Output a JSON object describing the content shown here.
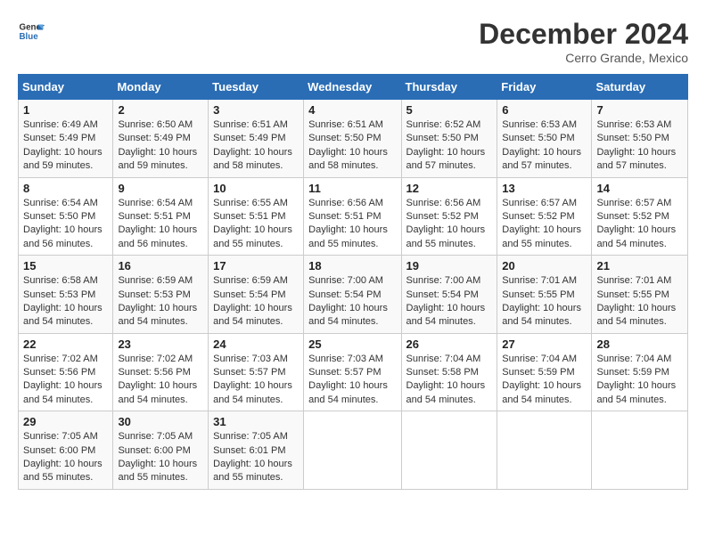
{
  "header": {
    "logo_line1": "General",
    "logo_line2": "Blue",
    "month": "December 2024",
    "location": "Cerro Grande, Mexico"
  },
  "columns": [
    "Sunday",
    "Monday",
    "Tuesday",
    "Wednesday",
    "Thursday",
    "Friday",
    "Saturday"
  ],
  "weeks": [
    [
      {
        "day": "1",
        "sunrise": "6:49 AM",
        "sunset": "5:49 PM",
        "daylight": "10 hours and 59 minutes."
      },
      {
        "day": "2",
        "sunrise": "6:50 AM",
        "sunset": "5:49 PM",
        "daylight": "10 hours and 59 minutes."
      },
      {
        "day": "3",
        "sunrise": "6:51 AM",
        "sunset": "5:49 PM",
        "daylight": "10 hours and 58 minutes."
      },
      {
        "day": "4",
        "sunrise": "6:51 AM",
        "sunset": "5:50 PM",
        "daylight": "10 hours and 58 minutes."
      },
      {
        "day": "5",
        "sunrise": "6:52 AM",
        "sunset": "5:50 PM",
        "daylight": "10 hours and 57 minutes."
      },
      {
        "day": "6",
        "sunrise": "6:53 AM",
        "sunset": "5:50 PM",
        "daylight": "10 hours and 57 minutes."
      },
      {
        "day": "7",
        "sunrise": "6:53 AM",
        "sunset": "5:50 PM",
        "daylight": "10 hours and 57 minutes."
      }
    ],
    [
      {
        "day": "8",
        "sunrise": "6:54 AM",
        "sunset": "5:50 PM",
        "daylight": "10 hours and 56 minutes."
      },
      {
        "day": "9",
        "sunrise": "6:54 AM",
        "sunset": "5:51 PM",
        "daylight": "10 hours and 56 minutes."
      },
      {
        "day": "10",
        "sunrise": "6:55 AM",
        "sunset": "5:51 PM",
        "daylight": "10 hours and 55 minutes."
      },
      {
        "day": "11",
        "sunrise": "6:56 AM",
        "sunset": "5:51 PM",
        "daylight": "10 hours and 55 minutes."
      },
      {
        "day": "12",
        "sunrise": "6:56 AM",
        "sunset": "5:52 PM",
        "daylight": "10 hours and 55 minutes."
      },
      {
        "day": "13",
        "sunrise": "6:57 AM",
        "sunset": "5:52 PM",
        "daylight": "10 hours and 55 minutes."
      },
      {
        "day": "14",
        "sunrise": "6:57 AM",
        "sunset": "5:52 PM",
        "daylight": "10 hours and 54 minutes."
      }
    ],
    [
      {
        "day": "15",
        "sunrise": "6:58 AM",
        "sunset": "5:53 PM",
        "daylight": "10 hours and 54 minutes."
      },
      {
        "day": "16",
        "sunrise": "6:59 AM",
        "sunset": "5:53 PM",
        "daylight": "10 hours and 54 minutes."
      },
      {
        "day": "17",
        "sunrise": "6:59 AM",
        "sunset": "5:54 PM",
        "daylight": "10 hours and 54 minutes."
      },
      {
        "day": "18",
        "sunrise": "7:00 AM",
        "sunset": "5:54 PM",
        "daylight": "10 hours and 54 minutes."
      },
      {
        "day": "19",
        "sunrise": "7:00 AM",
        "sunset": "5:54 PM",
        "daylight": "10 hours and 54 minutes."
      },
      {
        "day": "20",
        "sunrise": "7:01 AM",
        "sunset": "5:55 PM",
        "daylight": "10 hours and 54 minutes."
      },
      {
        "day": "21",
        "sunrise": "7:01 AM",
        "sunset": "5:55 PM",
        "daylight": "10 hours and 54 minutes."
      }
    ],
    [
      {
        "day": "22",
        "sunrise": "7:02 AM",
        "sunset": "5:56 PM",
        "daylight": "10 hours and 54 minutes."
      },
      {
        "day": "23",
        "sunrise": "7:02 AM",
        "sunset": "5:56 PM",
        "daylight": "10 hours and 54 minutes."
      },
      {
        "day": "24",
        "sunrise": "7:03 AM",
        "sunset": "5:57 PM",
        "daylight": "10 hours and 54 minutes."
      },
      {
        "day": "25",
        "sunrise": "7:03 AM",
        "sunset": "5:57 PM",
        "daylight": "10 hours and 54 minutes."
      },
      {
        "day": "26",
        "sunrise": "7:04 AM",
        "sunset": "5:58 PM",
        "daylight": "10 hours and 54 minutes."
      },
      {
        "day": "27",
        "sunrise": "7:04 AM",
        "sunset": "5:59 PM",
        "daylight": "10 hours and 54 minutes."
      },
      {
        "day": "28",
        "sunrise": "7:04 AM",
        "sunset": "5:59 PM",
        "daylight": "10 hours and 54 minutes."
      }
    ],
    [
      {
        "day": "29",
        "sunrise": "7:05 AM",
        "sunset": "6:00 PM",
        "daylight": "10 hours and 55 minutes."
      },
      {
        "day": "30",
        "sunrise": "7:05 AM",
        "sunset": "6:00 PM",
        "daylight": "10 hours and 55 minutes."
      },
      {
        "day": "31",
        "sunrise": "7:05 AM",
        "sunset": "6:01 PM",
        "daylight": "10 hours and 55 minutes."
      },
      null,
      null,
      null,
      null
    ]
  ],
  "labels": {
    "sunrise": "Sunrise:",
    "sunset": "Sunset:",
    "daylight": "Daylight:"
  }
}
